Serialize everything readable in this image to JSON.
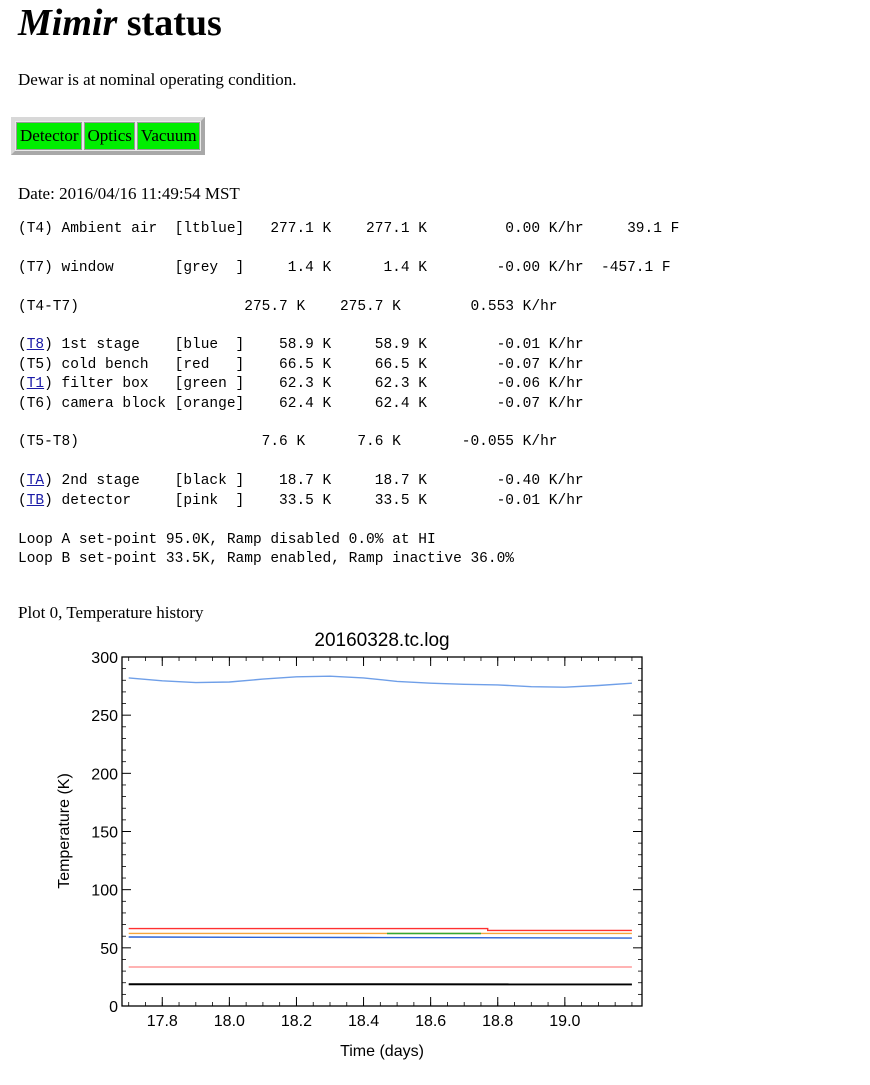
{
  "page": {
    "title_italic": "Mimir",
    "title_rest": " status",
    "status_message": "Dewar is at nominal operating condition.",
    "status_cells": [
      "Detector",
      "Optics",
      "Vacuum"
    ],
    "status_color": "#00ee00",
    "date_line": "Date: 2016/04/16 11:49:54 MST"
  },
  "readout": {
    "rows": [
      {
        "pre": "(",
        "link": "",
        "tag": "T4",
        "post": ") Ambient air  [ltblue]   277.1 K    277.1 K         0.00 K/hr     39.1 F"
      },
      {
        "blank": true
      },
      {
        "pre": "(",
        "link": "",
        "tag": "T7",
        "post": ") window       [grey  ]     1.4 K      1.4 K        -0.00 K/hr  -457.1 F"
      },
      {
        "blank": true
      },
      {
        "pre": "(T4-T7)                   275.7 K    275.7 K        0.553 K/hr",
        "link": "",
        "tag": "",
        "post": ""
      },
      {
        "blank": true
      },
      {
        "pre": "(",
        "link": "T8",
        "tag": "",
        "post": ") 1st stage    [blue  ]    58.9 K     58.9 K        -0.01 K/hr"
      },
      {
        "pre": "(",
        "link": "",
        "tag": "T5",
        "post": ") cold bench   [red   ]    66.5 K     66.5 K        -0.07 K/hr"
      },
      {
        "pre": "(",
        "link": "T1",
        "tag": "",
        "post": ") filter box   [green ]    62.3 K     62.3 K        -0.06 K/hr"
      },
      {
        "pre": "(",
        "link": "",
        "tag": "T6",
        "post": ") camera block [orange]    62.4 K     62.4 K        -0.07 K/hr"
      },
      {
        "blank": true
      },
      {
        "pre": "(T5-T8)                     7.6 K      7.6 K       -0.055 K/hr",
        "link": "",
        "tag": "",
        "post": ""
      },
      {
        "blank": true
      },
      {
        "pre": "(",
        "link": "TA",
        "tag": "",
        "post": ") 2nd stage    [black ]    18.7 K     18.7 K        -0.40 K/hr"
      },
      {
        "pre": "(",
        "link": "TB",
        "tag": "",
        "post": ") detector     [pink  ]    33.5 K     33.5 K        -0.01 K/hr"
      },
      {
        "blank": true
      },
      {
        "pre": "Loop A set-point 95.0K, Ramp disabled 0.0% at HI",
        "link": "",
        "tag": "",
        "post": ""
      },
      {
        "pre": "Loop B set-point 33.5K, Ramp enabled, Ramp inactive 36.0%",
        "link": "",
        "tag": "",
        "post": ""
      }
    ]
  },
  "plot_caption": "Plot 0, Temperature history",
  "chart_data": {
    "type": "line",
    "title": "20160328.tc.log",
    "xlabel": "Time (days)",
    "ylabel": "Temperature (K)",
    "xlim": [
      17.68,
      19.23
    ],
    "ylim": [
      0,
      300
    ],
    "xticks": [
      17.8,
      18.0,
      18.2,
      18.4,
      18.6,
      18.8,
      19.0
    ],
    "xtick_labels": [
      "17.8",
      "18.0",
      "18.2",
      "18.4",
      "18.6",
      "18.8",
      "19.0"
    ],
    "yticks": [
      0,
      50,
      100,
      150,
      200,
      250,
      300
    ],
    "ytick_labels": [
      "0",
      "50",
      "100",
      "150",
      "200",
      "250",
      "300"
    ],
    "series": [
      {
        "color": "#6f9fe8",
        "x": [
          17.7,
          17.8,
          17.9,
          18.0,
          18.1,
          18.2,
          18.3,
          18.4,
          18.5,
          18.6,
          18.7,
          18.8,
          18.9,
          19.0,
          19.1,
          19.2
        ],
        "y": [
          282,
          279.5,
          278,
          278.5,
          281,
          283,
          283.5,
          282,
          279,
          277.5,
          276.5,
          276,
          274.5,
          274,
          275.5,
          277.5
        ]
      },
      {
        "color": "#ff3030",
        "x": [
          17.7,
          18.77,
          18.77,
          19.2
        ],
        "y": [
          66.5,
          66.5,
          65,
          65
        ]
      },
      {
        "color": "#f7a63c",
        "x": [
          17.7,
          19.2
        ],
        "y": [
          62.4,
          62.4
        ]
      },
      {
        "color": "#33a833",
        "x": [
          18.47,
          18.75
        ],
        "y": [
          62.3,
          62.3
        ]
      },
      {
        "color": "#2a62d6",
        "x": [
          17.7,
          18.4,
          19.2
        ],
        "y": [
          59.3,
          58.9,
          58.4
        ]
      },
      {
        "color": "#ff9a9a",
        "x": [
          17.7,
          19.2
        ],
        "y": [
          33.5,
          33.5
        ]
      },
      {
        "color": "#000000",
        "x": [
          17.7,
          19.2
        ],
        "y": [
          18.7,
          18.6
        ]
      }
    ]
  }
}
